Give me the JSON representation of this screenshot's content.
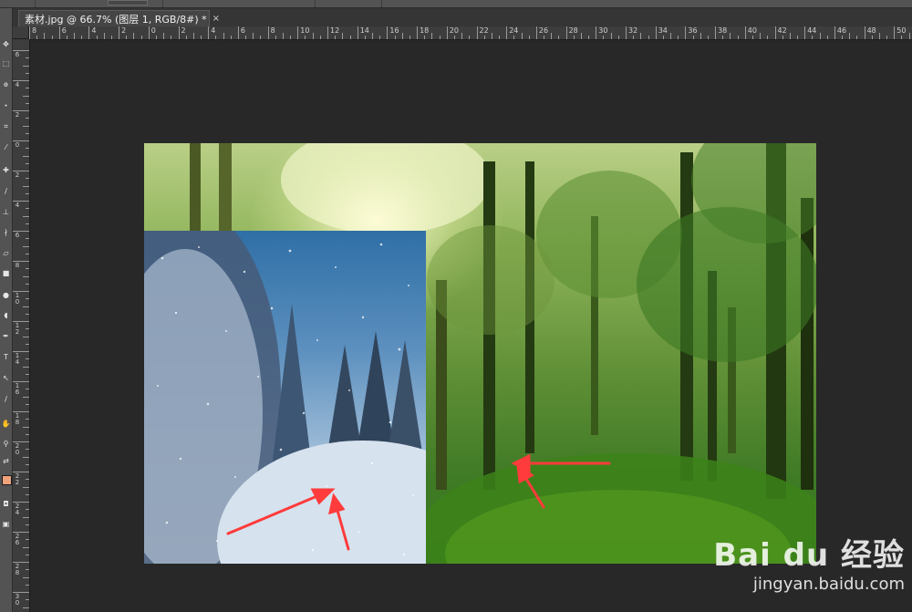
{
  "document": {
    "tab_title": "素材.jpg @ 66.7% (图层 1, RGB/8#) *",
    "close_glyph": "×"
  },
  "ruler": {
    "top_labels": [
      "8",
      "6",
      "4",
      "2",
      "0",
      "2",
      "4",
      "6",
      "8",
      "10",
      "12",
      "14",
      "16",
      "18",
      "20",
      "22",
      "24",
      "26",
      "28",
      "30",
      "32",
      "34",
      "36",
      "38",
      "40",
      "42",
      "44",
      "46",
      "48",
      "50"
    ],
    "left_labels": [
      "6",
      "4",
      "2",
      "0",
      "2",
      "4",
      "6",
      "8",
      "1\n0",
      "1\n2",
      "1\n4",
      "1\n6",
      "1\n8",
      "2\n0",
      "2\n2",
      "2\n4",
      "2\n6",
      "2\n8",
      "3\n0"
    ]
  },
  "canvas": {
    "background_image": "forest-sunlight",
    "inserted_layer": "snowy-pine-forest",
    "annotation_color": "#ff3b3b"
  },
  "watermark": {
    "logo": "Bai du 经验",
    "url": "jingyan.baidu.com"
  },
  "colors": {
    "workspace": "#282828",
    "panel": "#535353",
    "ruler": "#3d3d3d",
    "foreground_swatch": "#f0a27c"
  }
}
